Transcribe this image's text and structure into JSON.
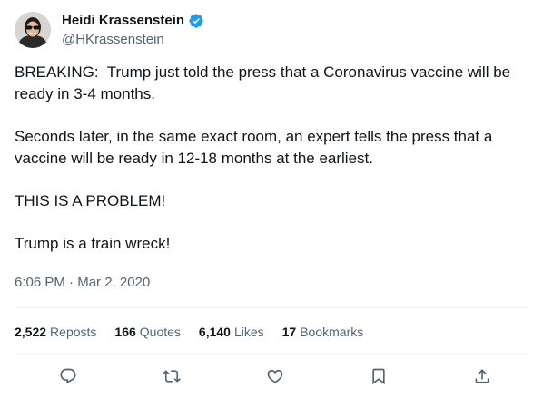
{
  "author": {
    "display_name": "Heidi Krassenstein",
    "handle": "@HKrassenstein",
    "verified_icon": "verified-badge-icon",
    "verified_color": "#1d9bf0"
  },
  "tweet": {
    "paragraphs": [
      "BREAKING:  Trump just told the press that a Coronavirus vaccine will be ready in 3-4 months.",
      "Seconds later, in the same exact room, an expert tells the press that a vaccine will be ready in 12-18 months at the earliest.",
      "THIS IS A PROBLEM!",
      "Trump is a train wreck!"
    ],
    "time": "6:06 PM",
    "separator": "·",
    "date": "Mar 2, 2020"
  },
  "stats": {
    "reposts": {
      "count": "2,522",
      "label": "Reposts"
    },
    "quotes": {
      "count": "166",
      "label": "Quotes"
    },
    "likes": {
      "count": "6,140",
      "label": "Likes"
    },
    "bookmarks": {
      "count": "17",
      "label": "Bookmarks"
    }
  },
  "actions": {
    "reply_icon": "reply-icon",
    "repost_icon": "repost-icon",
    "like_icon": "heart-icon",
    "bookmark_icon": "bookmark-icon",
    "share_icon": "share-icon",
    "icon_color": "#536471"
  }
}
